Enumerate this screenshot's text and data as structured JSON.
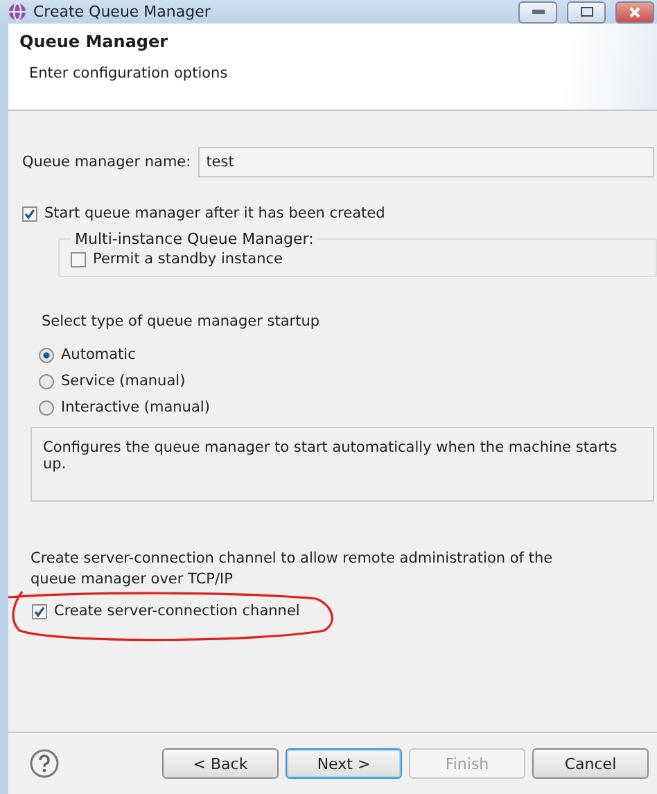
{
  "window": {
    "title": "Create Queue Manager"
  },
  "header": {
    "title": "Queue Manager",
    "subtitle": "Enter configuration options"
  },
  "name_field": {
    "label": "Queue manager name:",
    "value": "test"
  },
  "start_after_create": {
    "label": "Start queue manager after it has been created",
    "checked": true
  },
  "multi_instance": {
    "title": "Multi-instance Queue Manager:",
    "option": {
      "label": "Permit a standby instance",
      "checked": false
    }
  },
  "startup": {
    "label": "Select type of queue manager startup",
    "options": [
      {
        "label": "Automatic",
        "selected": true
      },
      {
        "label": "Service (manual)",
        "selected": false
      },
      {
        "label": "Interactive (manual)",
        "selected": false
      }
    ],
    "description": "Configures the queue manager to start automatically when the machine starts up."
  },
  "channel": {
    "info": "Create server-connection channel to allow remote administration of the queue manager over TCP/IP",
    "option": {
      "label": "Create server-connection channel",
      "checked": true
    },
    "annotated": true
  },
  "buttons": [
    {
      "label": "< Back",
      "disabled": false,
      "default": false
    },
    {
      "label": "Next >",
      "disabled": false,
      "default": true
    },
    {
      "label": "Finish",
      "disabled": true,
      "default": false
    },
    {
      "label": "Cancel",
      "disabled": false,
      "default": false
    }
  ]
}
